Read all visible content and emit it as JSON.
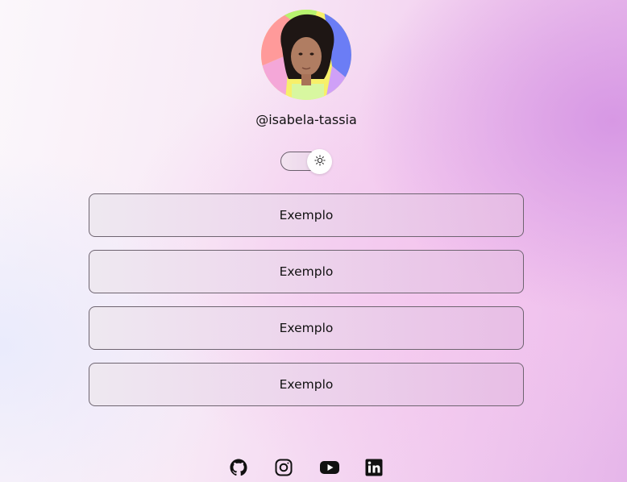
{
  "profile": {
    "handle": "@isabela-tassia"
  },
  "theme_toggle": {
    "icon": "sun-icon",
    "state": "light"
  },
  "links": [
    {
      "label": "Exemplo"
    },
    {
      "label": "Exemplo"
    },
    {
      "label": "Exemplo"
    },
    {
      "label": "Exemplo"
    }
  ],
  "socials": [
    {
      "icon": "github-icon"
    },
    {
      "icon": "instagram-icon"
    },
    {
      "icon": "youtube-icon"
    },
    {
      "icon": "linkedin-icon"
    }
  ]
}
